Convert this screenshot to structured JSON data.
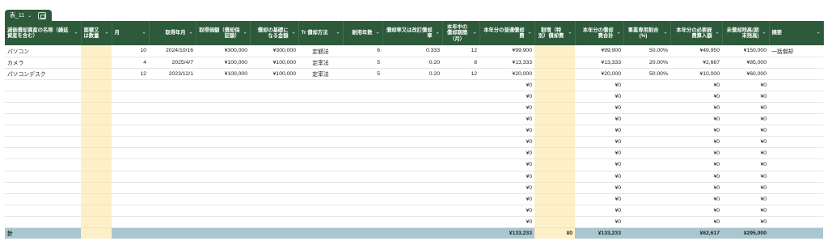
{
  "tab": {
    "name": "表_11",
    "chevron": "chevron-down-icon",
    "copy": "copy-icon"
  },
  "headers": [
    {
      "label": "減価償却資産の名称（繰延資産を含む）"
    },
    {
      "label": "面積又は数量"
    },
    {
      "label": "月"
    },
    {
      "label": "取得年月"
    },
    {
      "label": "取得価額（償却保証額）"
    },
    {
      "label": "償却の基礎になる金額"
    },
    {
      "label": "Tr 償却方法"
    },
    {
      "label": "耐用年数"
    },
    {
      "label": "償却率又は改訂償却率"
    },
    {
      "label": "本年中の償却期間（月）"
    },
    {
      "label": "本年分の普通償却費"
    },
    {
      "label": "割増（特別）償却費"
    },
    {
      "label": "本年分の償却費合計"
    },
    {
      "label": "事業専用割合(%)"
    },
    {
      "label": "本年分の必要経費算入額"
    },
    {
      "label": "未償却残高(期末残高)"
    },
    {
      "label": "摘要"
    }
  ],
  "rows": [
    [
      "パソコン",
      "",
      "10",
      "2024/10/16",
      "¥300,000",
      "¥300,000",
      "定額法",
      "6",
      "0.333",
      "12",
      "¥99,900",
      "",
      "¥99,900",
      "50.00%",
      "¥49,950",
      "¥150,000",
      "一括償却"
    ],
    [
      "カメラ",
      "",
      "4",
      "2025/4/7",
      "¥100,000",
      "¥100,000",
      "定率法",
      "5",
      "0.20",
      "8",
      "¥13,333",
      "",
      "¥13,333",
      "20.00%",
      "¥2,667",
      "¥85,000",
      ""
    ],
    [
      "パソコンデスク",
      "",
      "12",
      "2023/12/1",
      "¥100,000",
      "¥100,000",
      "定率法",
      "5",
      "0.20",
      "12",
      "¥20,000",
      "",
      "¥20,000",
      "50.00%",
      "¥10,000",
      "¥60,000",
      ""
    ],
    [
      "",
      "",
      "",
      "",
      "",
      "",
      "",
      "",
      "",
      "",
      "¥0",
      "",
      "¥0",
      "",
      "¥0",
      "¥0",
      ""
    ],
    [
      "",
      "",
      "",
      "",
      "",
      "",
      "",
      "",
      "",
      "",
      "¥0",
      "",
      "¥0",
      "",
      "¥0",
      "¥0",
      ""
    ],
    [
      "",
      "",
      "",
      "",
      "",
      "",
      "",
      "",
      "",
      "",
      "¥0",
      "",
      "¥0",
      "",
      "¥0",
      "¥0",
      ""
    ],
    [
      "",
      "",
      "",
      "",
      "",
      "",
      "",
      "",
      "",
      "",
      "¥0",
      "",
      "¥0",
      "",
      "¥0",
      "¥0",
      ""
    ],
    [
      "",
      "",
      "",
      "",
      "",
      "",
      "",
      "",
      "",
      "",
      "¥0",
      "",
      "¥0",
      "",
      "¥0",
      "¥0",
      ""
    ],
    [
      "",
      "",
      "",
      "",
      "",
      "",
      "",
      "",
      "",
      "",
      "¥0",
      "",
      "¥0",
      "",
      "¥0",
      "¥0",
      ""
    ],
    [
      "",
      "",
      "",
      "",
      "",
      "",
      "",
      "",
      "",
      "",
      "¥0",
      "",
      "¥0",
      "",
      "¥0",
      "¥0",
      ""
    ],
    [
      "",
      "",
      "",
      "",
      "",
      "",
      "",
      "",
      "",
      "",
      "¥0",
      "",
      "¥0",
      "",
      "¥0",
      "¥0",
      ""
    ],
    [
      "",
      "",
      "",
      "",
      "",
      "",
      "",
      "",
      "",
      "",
      "¥0",
      "",
      "¥0",
      "",
      "¥0",
      "¥0",
      ""
    ],
    [
      "",
      "",
      "",
      "",
      "",
      "",
      "",
      "",
      "",
      "",
      "¥0",
      "",
      "¥0",
      "",
      "¥0",
      "¥0",
      ""
    ],
    [
      "",
      "",
      "",
      "",
      "",
      "",
      "",
      "",
      "",
      "",
      "¥0",
      "",
      "¥0",
      "",
      "¥0",
      "¥0",
      ""
    ],
    [
      "",
      "",
      "",
      "",
      "",
      "",
      "",
      "",
      "",
      "",
      "¥0",
      "",
      "¥0",
      "",
      "¥0",
      "¥0",
      ""
    ],
    [
      "",
      "",
      "",
      "",
      "",
      "",
      "",
      "",
      "",
      "",
      "¥0",
      "",
      "¥0",
      "",
      "¥0",
      "¥0",
      ""
    ]
  ],
  "total": [
    "計",
    "",
    "",
    "",
    "",
    "",
    "",
    "",
    "",
    "",
    "¥133,233",
    "¥0",
    "¥133,233",
    "",
    "¥62,617",
    "¥295,000",
    ""
  ],
  "colors": {
    "header": "#2d5a3a",
    "highlight": "#fdf0c8",
    "total": "#a9c7cf"
  }
}
